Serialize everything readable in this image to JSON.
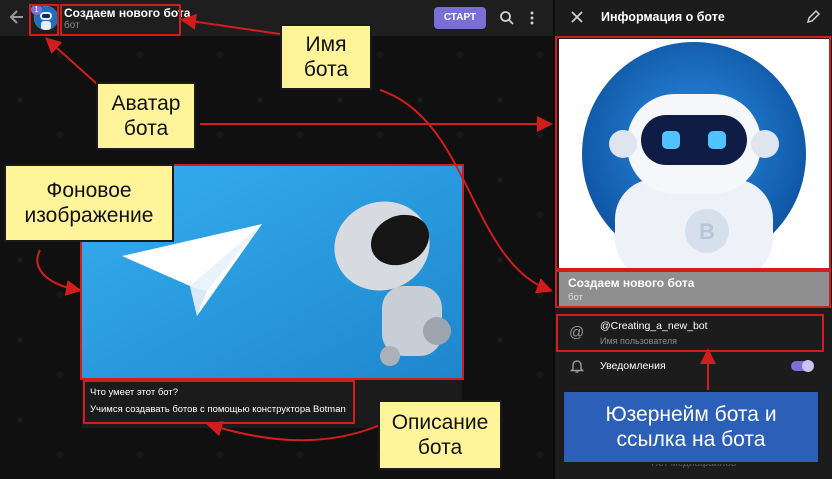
{
  "chat": {
    "badge_count": "1",
    "bot_name": "Создаем нового бота",
    "bot_status": "бот",
    "start_button": "СТАРТ",
    "description_title": "Что умеет этот бот?",
    "description_text": "Учимся создавать ботов с помощью конструктора Botman"
  },
  "info": {
    "header_title": "Информация о боте",
    "bot_name": "Создаем нового бота",
    "bot_status": "бот",
    "username": "@Creating_a_new_bot",
    "username_label": "Имя пользователя",
    "notifications_label": "Уведомления",
    "notifications_on": true,
    "footer_text": "Нет медиафайлов"
  },
  "callouts": {
    "name": "Имя\nбота",
    "avatar": "Аватар\nбота",
    "background": "Фоновое\nизображение",
    "description": "Описание\nбота",
    "username": "Юзернейм бота и\nссылка на бота"
  },
  "colors": {
    "accent": "#7b6fd6",
    "annotation_red": "#d21d1d",
    "callout_yellow": "#fff49a",
    "callout_blue": "#2b5fb8",
    "telegram_blue": "#2aa3e3"
  }
}
